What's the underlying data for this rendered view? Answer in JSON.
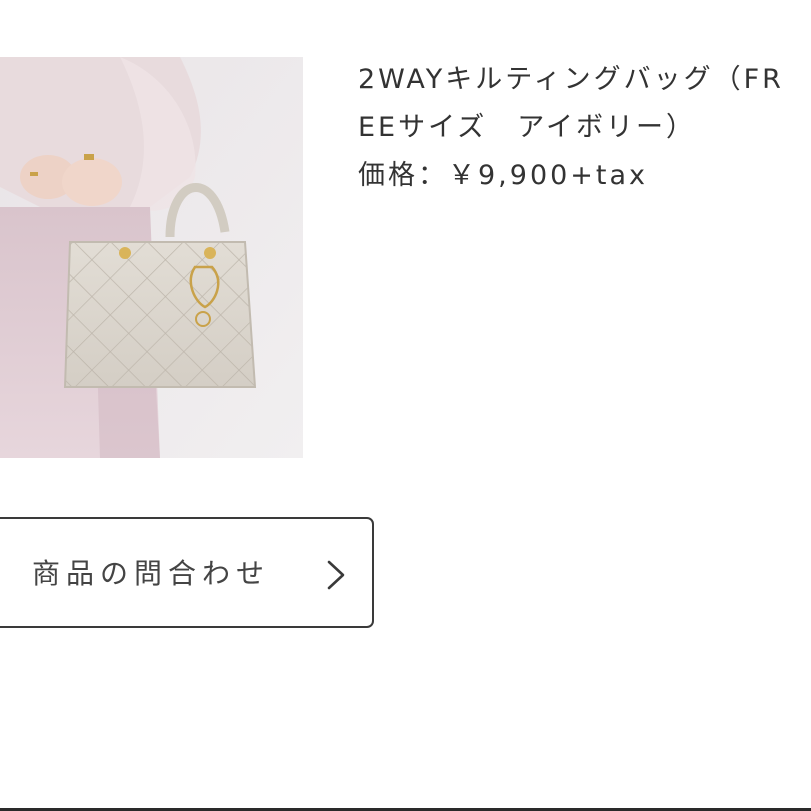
{
  "product": {
    "title": "2WAYキルティングバッグ（FREEサイズ　アイボリー）",
    "price_label": "価格：",
    "price_value": "￥9,900+tax",
    "image_icon": "product-photo"
  },
  "inquiry": {
    "label": "商品の問合わせ",
    "icon": "chevron-right-icon"
  },
  "colors": {
    "text": "#333333",
    "border": "#3a3a3a",
    "background": "#ffffff"
  }
}
